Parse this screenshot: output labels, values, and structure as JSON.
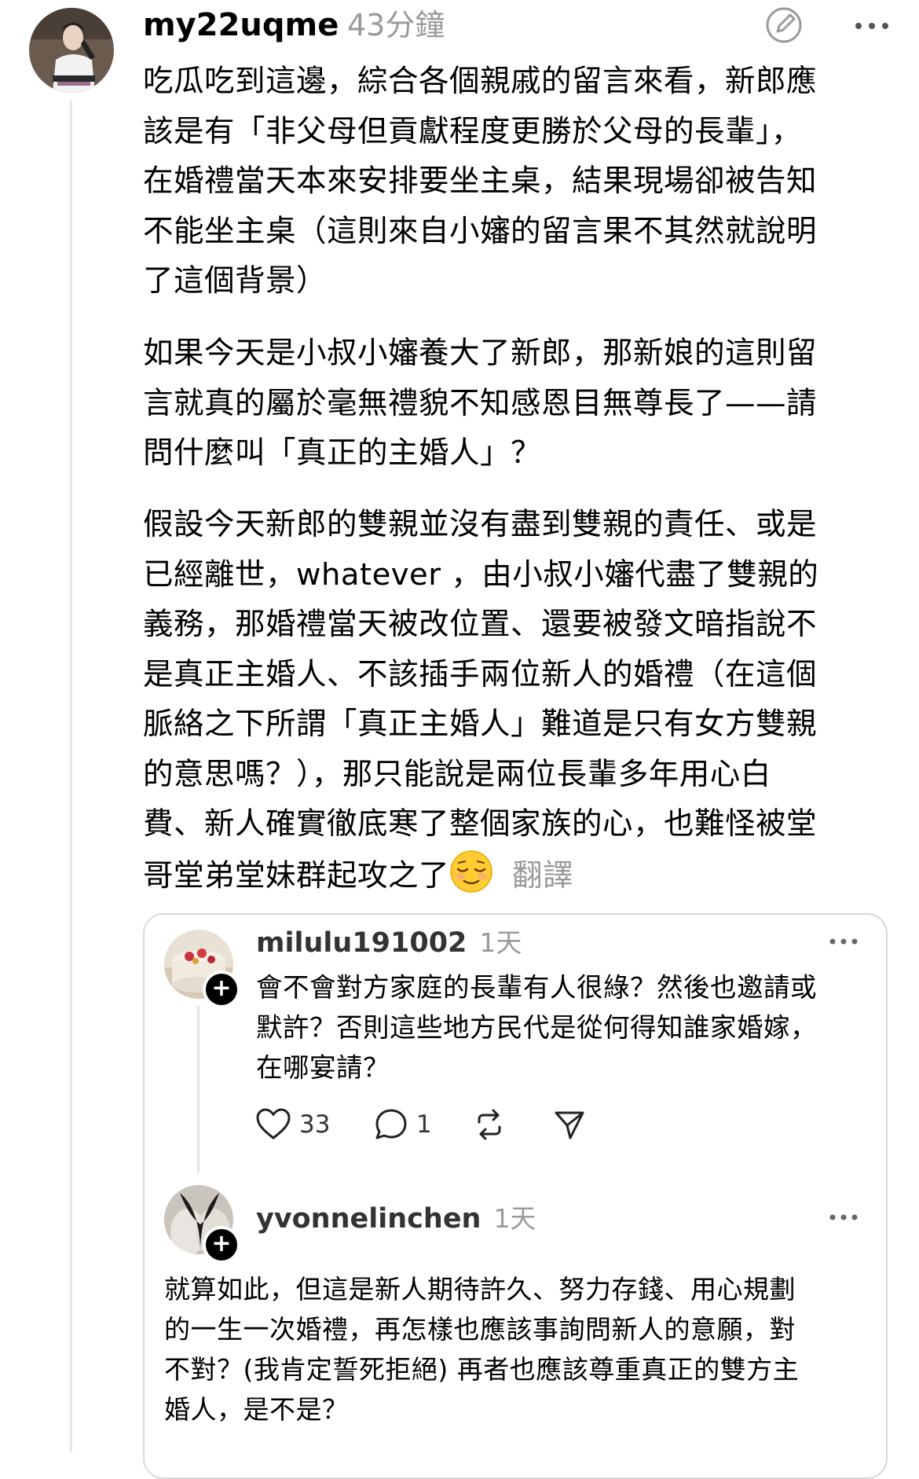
{
  "post": {
    "username": "my22uqme",
    "time": "43分鐘",
    "paragraphs": [
      "吃瓜吃到這邊，綜合各個親戚的留言來看，新郎應\n該是有「非父母但貢獻程度更勝於父母的長輩」，\n在婚禮當天本來安排要坐主桌，結果現場卻被告知\n不能坐主桌（這則來自小嬸的留言果不其然就說明\n了這個背景）",
      "如果今天是小叔小嬸養大了新郎，那新娘的這則留\n言就真的屬於毫無禮貌不知感恩目無尊長了——請\n問什麼叫「真正的主婚人」？",
      "假設今天新郎的雙親並沒有盡到雙親的責任、或是\n已經離世，whatever ，由小叔小嬸代盡了雙親的\n義務，那婚禮當天被改位置、還要被發文暗指說不\n是真正主婚人、不該插手兩位新人的婚禮（在這個\n脈絡之下所謂「真正主婚人」難道是只有女方雙親\n的意思嗎？），那只能說是兩位長輩多年用心白\n費、新人確實徹底寒了整個家族的心，也難怪被堂\n哥堂弟堂妹群起攻之了"
    ],
    "translate_label": "翻譯",
    "emoji": "relieved-face"
  },
  "quoted": {
    "reply1": {
      "username": "milulu191002",
      "time": "1天",
      "text": "會不會對方家庭的長輩有人很綠？然後也邀請或\n默許？否則這些地方民代是從何得知誰家婚嫁，\n在哪宴請？",
      "likes": "33",
      "comments": "1"
    },
    "reply2": {
      "username": "yvonnelinchen",
      "time": "1天",
      "text": "就算如此，但這是新人期待許久、努力存錢、用心規劃\n的一生一次婚禮，再怎樣也應該事詢問新人的意願，對\n不對？(我肯定誓死拒絕) 再者也應該尊重真正的雙方主\n婚人，是不是？"
    }
  }
}
